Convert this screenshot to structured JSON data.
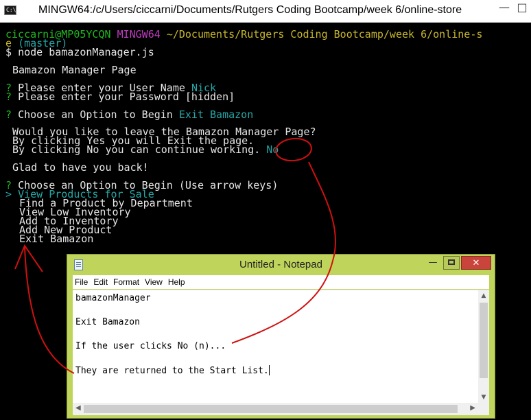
{
  "terminal": {
    "title": "MINGW64:/c/Users/ciccarni/Documents/Rutgers Coding Bootcamp/week 6/online-store",
    "icon": "console-icon",
    "prompt": {
      "user_host": "ciccarni@MP05YCQN",
      "env": "MINGW64",
      "path": "~/Documents/Rutgers Coding Bootcamp/week 6/online-s",
      "path_wrap": "e",
      "branch": "(master)",
      "symbol": "$",
      "command": "node bamazonManager.js"
    },
    "lines": {
      "header": "Bamazon Manager Page",
      "q_mark": "?",
      "username_label": "Please enter your User Name",
      "username_value": "Nick",
      "password_label": "Please enter your Password",
      "password_value": "[hidden]",
      "choose_label": "Choose an Option to Begin",
      "choose_value": "Exit Bamazon",
      "leave_question": "Would you like to leave the Bamazon Manager Page?",
      "leave_yes": "By clicking Yes you will Exit the page.",
      "leave_no": "By clicking No you can continue working.",
      "leave_answer": "No",
      "glad": "Glad to have you back!",
      "choose_again_label": "Choose an Option to Begin",
      "choose_again_hint": "(Use arrow keys)",
      "pointer": ">"
    },
    "menu": [
      "View Products for Sale",
      "Find a Product by Department",
      "View Low Inventory",
      "Add to Inventory",
      "Add New Product",
      "Exit Bamazon"
    ],
    "minimize_glyph": "—",
    "restore_glyph": "□"
  },
  "notepad": {
    "title": "Untitled - Notepad",
    "menus": [
      "File",
      "Edit",
      "Format",
      "View",
      "Help"
    ],
    "lines": [
      "bamazonManager",
      "",
      "Exit Bamazon",
      "",
      "If the user clicks No (n)...",
      "",
      "They are returned to the Start List."
    ],
    "minimize_glyph": "—",
    "close_glyph": "✕"
  },
  "colors": {
    "terminal_bg": "#000000",
    "prompt_green": "#21b821",
    "prompt_magenta": "#c03bc0",
    "path_yellow": "#c9b72e",
    "answer_cyan": "#25a6a6",
    "notepad_frame": "#bfd45a",
    "annotation_red": "#d01010"
  }
}
